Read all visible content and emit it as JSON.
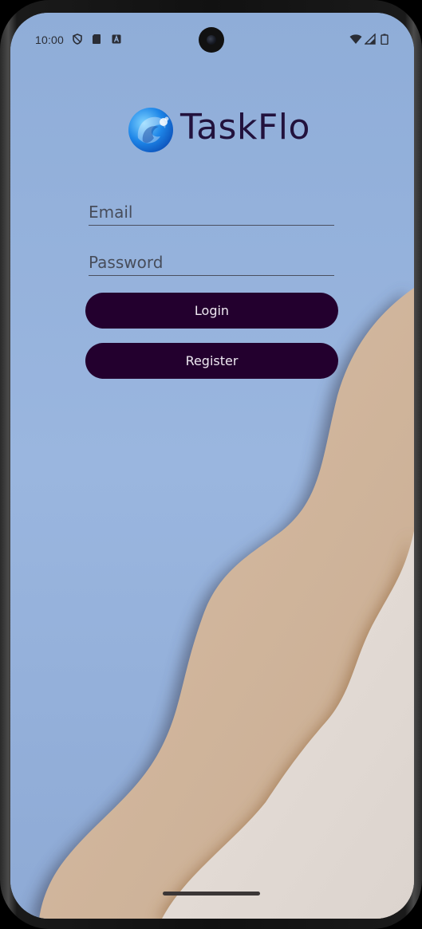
{
  "status_bar": {
    "time": "10:00",
    "left_icons": [
      "shield-icon",
      "sd-card-icon",
      "a-badge-icon"
    ],
    "right_icons": [
      "wifi-icon",
      "signal-icon",
      "battery-icon"
    ]
  },
  "app": {
    "title": "TaskFlo",
    "logo_icon": "wave-logo-icon"
  },
  "form": {
    "email_placeholder": "Email",
    "email_value": "",
    "password_placeholder": "Password",
    "password_value": "",
    "login_label": "Login",
    "register_label": "Register"
  },
  "colors": {
    "background_blue": "#94b1d8",
    "sand": "#cfb49a",
    "paper": "#e4dcd6",
    "button": "#23002e",
    "title": "#22123d"
  }
}
